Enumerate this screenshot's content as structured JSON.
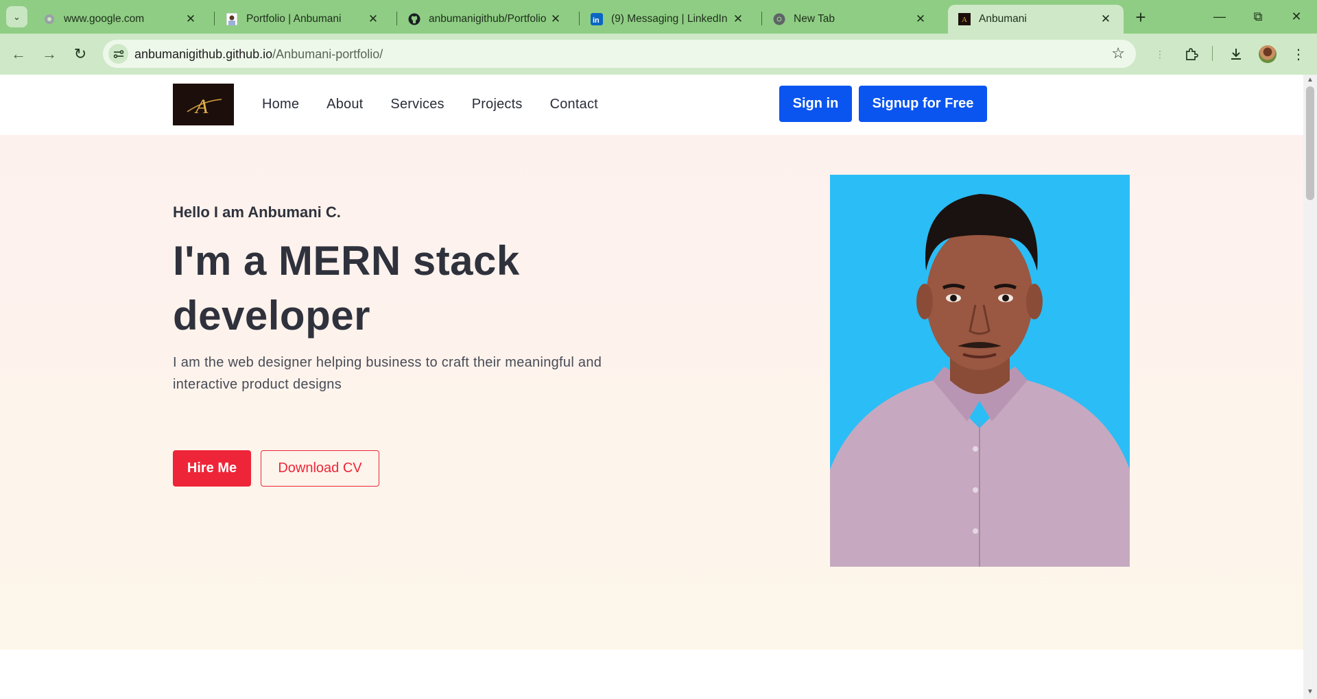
{
  "browser": {
    "tabs": [
      {
        "title": "www.google.com",
        "favicon": "globe-icon",
        "active": false
      },
      {
        "title": "Portfolio | Anbumani",
        "favicon": "portrait-favicon",
        "active": false
      },
      {
        "title": "anbumanigithub/Portfolio",
        "favicon": "github-icon",
        "active": false
      },
      {
        "title": "(9) Messaging | LinkedIn",
        "favicon": "linkedin-icon",
        "active": false
      },
      {
        "title": "New Tab",
        "favicon": "chrome-icon",
        "active": false
      },
      {
        "title": "Anbumani",
        "favicon": "site-logo-favicon",
        "active": true
      }
    ],
    "url_host": "anbumanigithub.github.io",
    "url_path": "/Anbumani-portfolio/",
    "colors": {
      "tabstrip": "#8fcd84",
      "toolbar": "#cfe9c8"
    }
  },
  "site": {
    "logo_letter": "A",
    "nav": [
      "Home",
      "About",
      "Services",
      "Projects",
      "Contact"
    ],
    "signin_label": "Sign in",
    "signup_label": "Signup for Free",
    "accent_blue": "#0a55f0"
  },
  "hero": {
    "greeting": "Hello I am Anbumani C.",
    "headline": "I'm a MERN stack developer",
    "description": "I am the web designer helping business to craft their meaningful and interactive product designs",
    "hire_label": "Hire Me",
    "cv_label": "Download CV",
    "accent_red": "#ee2538"
  }
}
